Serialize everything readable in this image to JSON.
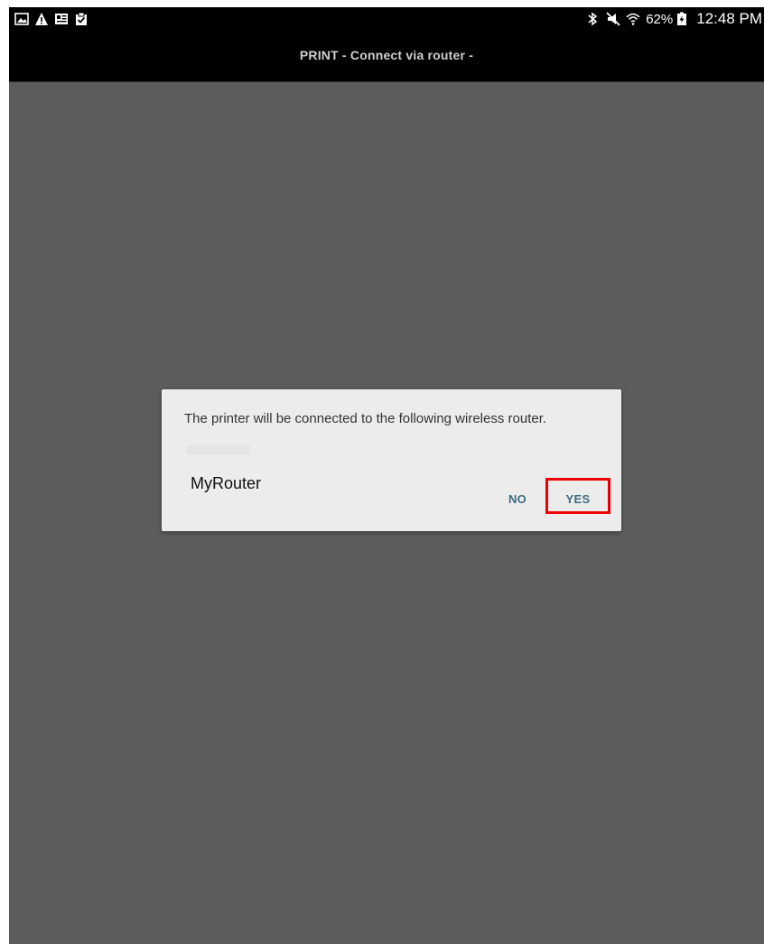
{
  "status_bar": {
    "left_icons": [
      "gallery-icon",
      "warning-icon",
      "news-icon",
      "clipboard-check-icon"
    ],
    "right_icons": [
      "bluetooth-icon",
      "mute-icon",
      "wifi-icon",
      "battery-icon"
    ],
    "battery_percent": "62%",
    "time": "12:48 PM"
  },
  "title_bar": {
    "title": "PRINT  - Connect via router -"
  },
  "dialog": {
    "message": "The printer will be connected to the following wireless router.",
    "router_name": "MyRouter",
    "no_label": "NO",
    "yes_label": "YES"
  },
  "colors": {
    "background": "#5c5c5c",
    "status_bar": "#000000",
    "dialog_bg": "#ececec",
    "button_text": "#3d6b82",
    "highlight": "#ee0000"
  }
}
